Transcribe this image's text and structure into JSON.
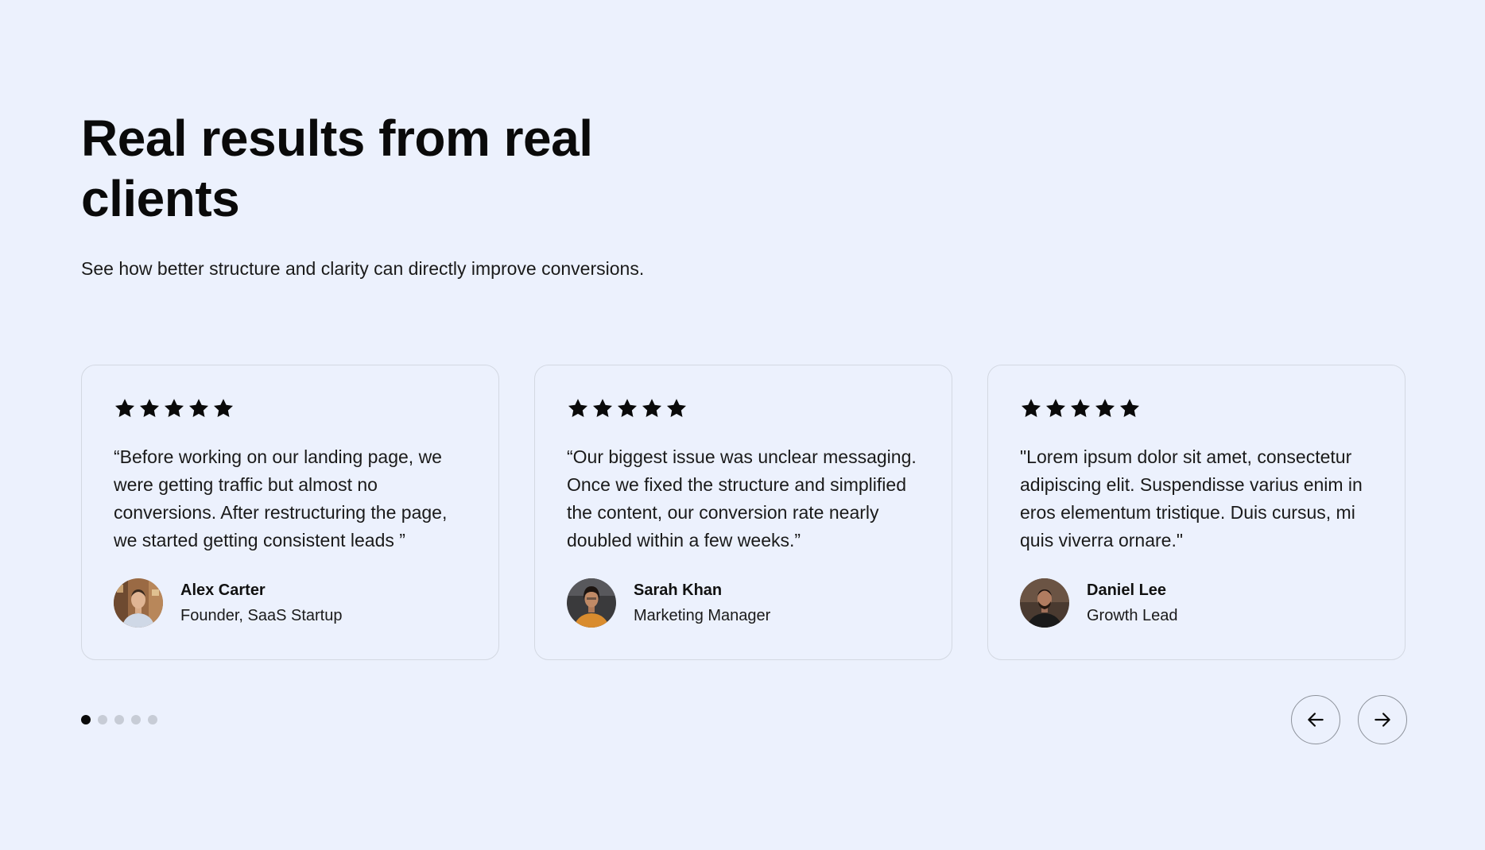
{
  "section": {
    "title": "Real results from real clients",
    "subtitle": "See how better structure and clarity can directly improve conversions."
  },
  "testimonials": [
    {
      "rating": 5,
      "quote": "“Before working on our landing page, we were getting traffic but almost no conversions. After restructuring the page, we started getting consistent leads ”",
      "name": "Alex Carter",
      "role": "Founder, SaaS Startup",
      "avatar_icon": "avatar-photo-alex"
    },
    {
      "rating": 5,
      "quote": "“Our biggest issue was unclear messaging. Once we fixed the structure and simplified the content, our conversion rate nearly doubled within a few weeks.”",
      "name": "Sarah Khan",
      "role": "Marketing Manager",
      "avatar_icon": "avatar-photo-sarah"
    },
    {
      "rating": 5,
      "quote": "\"Lorem ipsum dolor sit amet, consectetur adipiscing elit. Suspendisse varius enim in eros elementum tristique. Duis cursus, mi quis viverra ornare.\"",
      "name": "Daniel Lee",
      "role": "Growth Lead",
      "avatar_icon": "avatar-photo-daniel"
    }
  ],
  "pagination": {
    "total": 5,
    "active_index": 0
  },
  "navigation": {
    "prev_icon": "arrow-left-icon",
    "next_icon": "arrow-right-icon"
  },
  "colors": {
    "background": "#ecf1fd",
    "text": "#0a0a0a",
    "card_border": "#d3d8e2",
    "dot_inactive": "#c7ccd6",
    "dot_active": "#0a0a0a",
    "star": "#0a0a0a"
  }
}
